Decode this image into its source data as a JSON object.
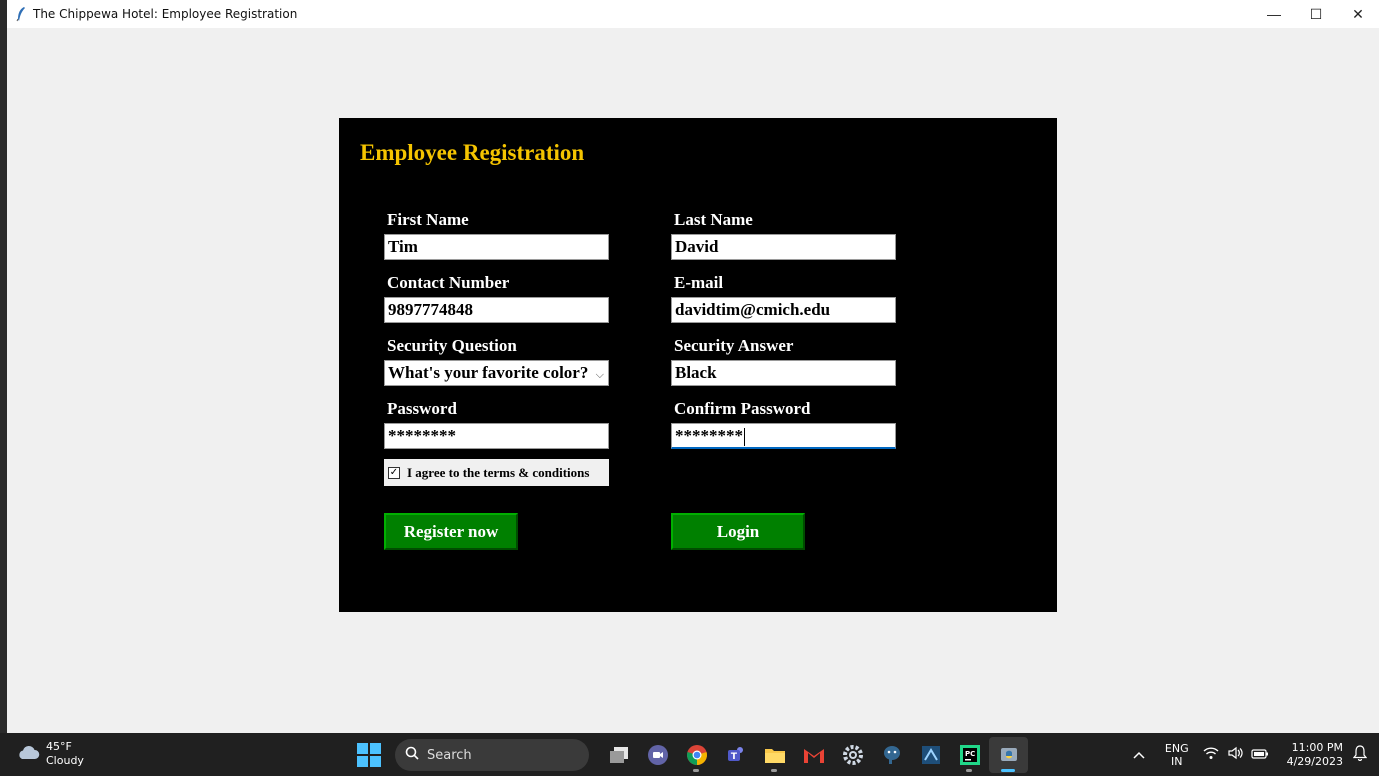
{
  "window": {
    "title": "The Chippewa Hotel: Employee Registration",
    "minimize_glyph": "—",
    "maximize_glyph": "☐",
    "close_glyph": "✕"
  },
  "form": {
    "heading": "Employee Registration",
    "first_name": {
      "label": "First Name",
      "value": "Tim"
    },
    "last_name": {
      "label": "Last Name",
      "value": "David"
    },
    "contact_number": {
      "label": "Contact Number",
      "value": "9897774848"
    },
    "email": {
      "label": "E-mail",
      "value": "davidtim@cmich.edu"
    },
    "security_question": {
      "label": "Security Question",
      "value": "What's your favorite color?"
    },
    "security_answer": {
      "label": "Security Answer",
      "value": "Black"
    },
    "password": {
      "label": "Password",
      "value": "********"
    },
    "confirm_password": {
      "label": "Confirm Password",
      "value": "********"
    },
    "terms": {
      "label": "I agree to the terms & conditions",
      "checked": true,
      "check_glyph": "✓"
    },
    "register_label": "Register now",
    "login_label": "Login"
  },
  "colors": {
    "panel_bg": "#000000",
    "heading": "#f5c400",
    "button_bg": "#008000",
    "window_bg": "#f0f0f0"
  },
  "taskbar": {
    "weather_temp": "45°F",
    "weather_desc": "Cloudy",
    "search_placeholder": "Search",
    "apps": [
      "task-view-icon",
      "meet-icon",
      "chrome-icon",
      "teams-icon",
      "file-explorer-icon",
      "gmail-icon",
      "settings-icon",
      "postgresql-icon",
      "sql-developer-icon",
      "pycharm-icon",
      "python-icon"
    ],
    "lang_line1": "ENG",
    "lang_line2": "IN",
    "time": "11:00 PM",
    "date": "4/29/2023"
  }
}
